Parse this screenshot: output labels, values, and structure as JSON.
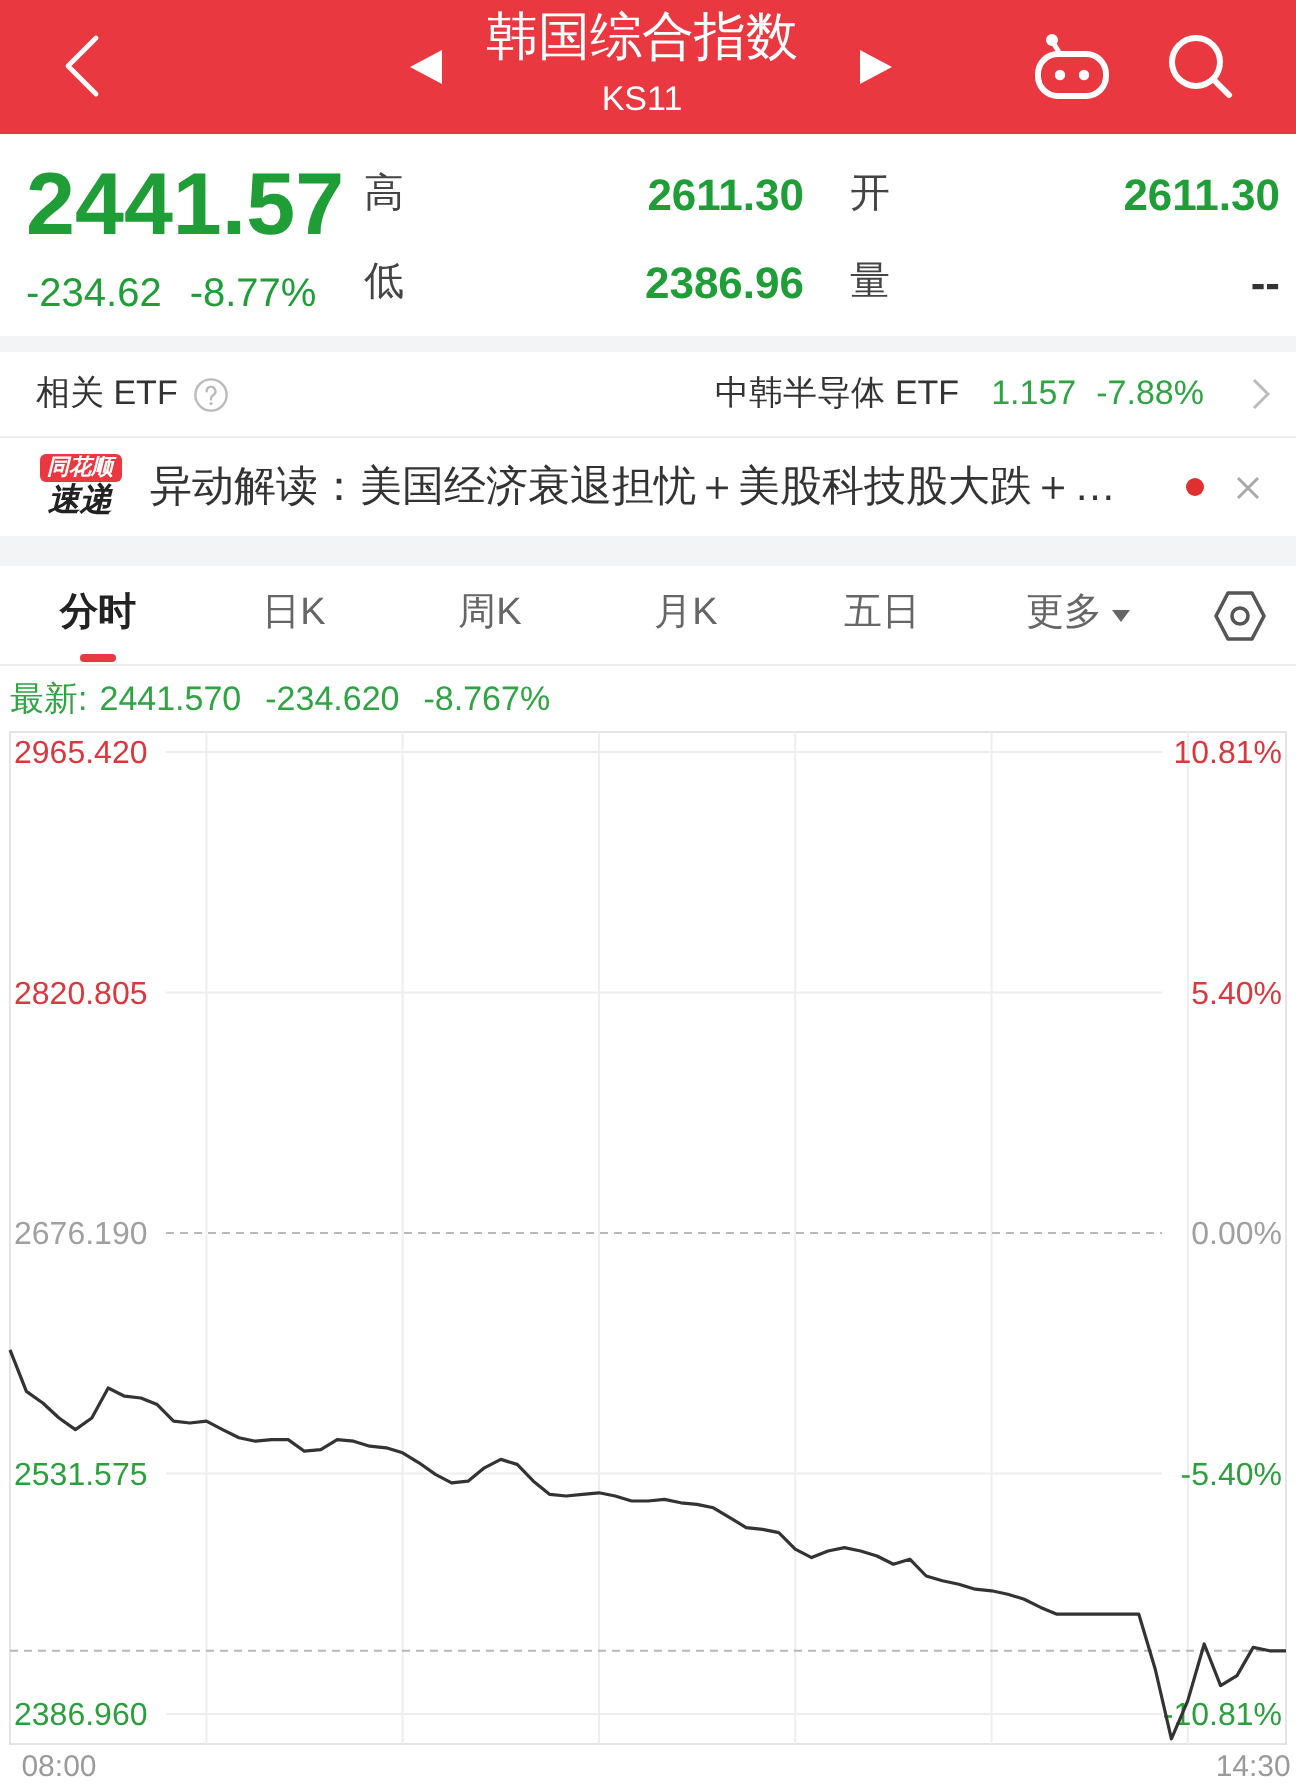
{
  "header": {
    "title": "韩国综合指数",
    "code": "KS11"
  },
  "quote": {
    "price": "2441.57",
    "change": "-234.62",
    "change_pct": "-8.77%",
    "falling": true,
    "stats": [
      {
        "label": "高",
        "value": "2611.30",
        "color": "#1f9d36"
      },
      {
        "label": "开",
        "value": "2611.30",
        "color": "#1f9d36"
      },
      {
        "label": "低",
        "value": "2386.96",
        "color": "#1f9d36"
      },
      {
        "label": "量",
        "value": "--",
        "color": "#333333"
      }
    ]
  },
  "related_etf": {
    "label": "相关 ETF",
    "name": "中韩半导体 ETF",
    "price": "1.157",
    "change_pct": "-7.88%",
    "falling": true
  },
  "news": {
    "source_tag": "同花顺",
    "source_label": "速递",
    "headline": "异动解读：美国经济衰退担忧＋美股科技股大跌＋…",
    "unread": true
  },
  "tabs": [
    {
      "label": "分时",
      "selected": true,
      "kind": "tab"
    },
    {
      "label": "日K",
      "selected": false,
      "kind": "tab"
    },
    {
      "label": "周K",
      "selected": false,
      "kind": "tab"
    },
    {
      "label": "月K",
      "selected": false,
      "kind": "tab"
    },
    {
      "label": "五日",
      "selected": false,
      "kind": "tab"
    },
    {
      "label": "更多",
      "selected": false,
      "kind": "menu"
    }
  ],
  "chart": {
    "latest": {
      "label": "最新:",
      "price": "2441.570",
      "change": "-234.620",
      "change_pct": "-8.767%",
      "falling": true
    },
    "right_ticks": [
      {
        "label": "10.81%",
        "color": "#d9383e"
      },
      {
        "label": "5.40%",
        "color": "#d9383e"
      },
      {
        "label": "0.00%",
        "color": "#a0a0a0"
      },
      {
        "label": "-5.40%",
        "color": "#2c9f3d"
      },
      {
        "label": "-10.81%",
        "color": "#2c9f3d"
      }
    ],
    "chart_data": {
      "type": "line",
      "grid": true,
      "categories": [
        null,
        null,
        null,
        "08:00",
        null,
        null,
        null,
        null,
        null,
        null,
        null,
        null,
        null,
        null,
        null,
        null,
        null,
        null,
        null,
        null,
        null,
        null,
        null,
        null,
        null,
        null,
        null,
        null,
        null,
        null,
        null,
        null,
        null,
        null,
        null,
        null,
        null,
        null,
        null,
        null,
        null,
        null,
        null,
        null,
        null,
        null,
        null,
        null,
        null,
        null,
        null,
        null,
        null,
        null,
        null,
        null,
        null,
        null,
        null,
        null,
        null,
        null,
        null,
        null,
        null,
        null,
        null,
        null,
        null,
        null,
        null,
        null,
        null,
        null,
        null,
        null,
        "14:30",
        null,
        null
      ],
      "series": [
        {
          "color": "#333333",
          "values": [
            2606,
            2581,
            2574,
            2565,
            2558,
            2565,
            2583,
            2578,
            2577,
            2573,
            2563,
            2562,
            2563,
            2558,
            2553,
            2551,
            2552,
            2552,
            2545,
            2546,
            2552,
            2551,
            2548,
            2547,
            2544,
            2538,
            2531,
            2526,
            2527,
            2535,
            2540,
            2537,
            2527,
            2519,
            2518,
            2519,
            2520,
            2518,
            2515,
            2515,
            2516,
            2514,
            2513,
            2511,
            2505,
            2499,
            2498,
            2496,
            2486,
            2481,
            2485,
            2487,
            2485,
            2482,
            2477,
            2480,
            2470,
            2467,
            2465,
            2462,
            2461,
            2459,
            2456,
            2451,
            2447,
            2447,
            2447,
            2447,
            2447,
            2447,
            2414,
            2372,
            2395,
            2429,
            2404,
            2410,
            2427,
            2425,
            2425
          ]
        }
      ],
      "ylim": [
        2368.92,
        2977.45
      ],
      "yticks": [
        {
          "value": 2965.42,
          "label": "2965.420"
        },
        {
          "value": 2820.805,
          "label": "2820.805"
        },
        {
          "value": 2676.19,
          "label": "2676.190"
        },
        {
          "value": 2531.575,
          "label": "2531.575"
        },
        {
          "value": 2386.96,
          "label": "2386.960"
        }
      ],
      "ref_lines": [
        {
          "axis": "y",
          "value": 2676.19
        },
        {
          "axis": "y",
          "value": 2425
        }
      ]
    }
  }
}
